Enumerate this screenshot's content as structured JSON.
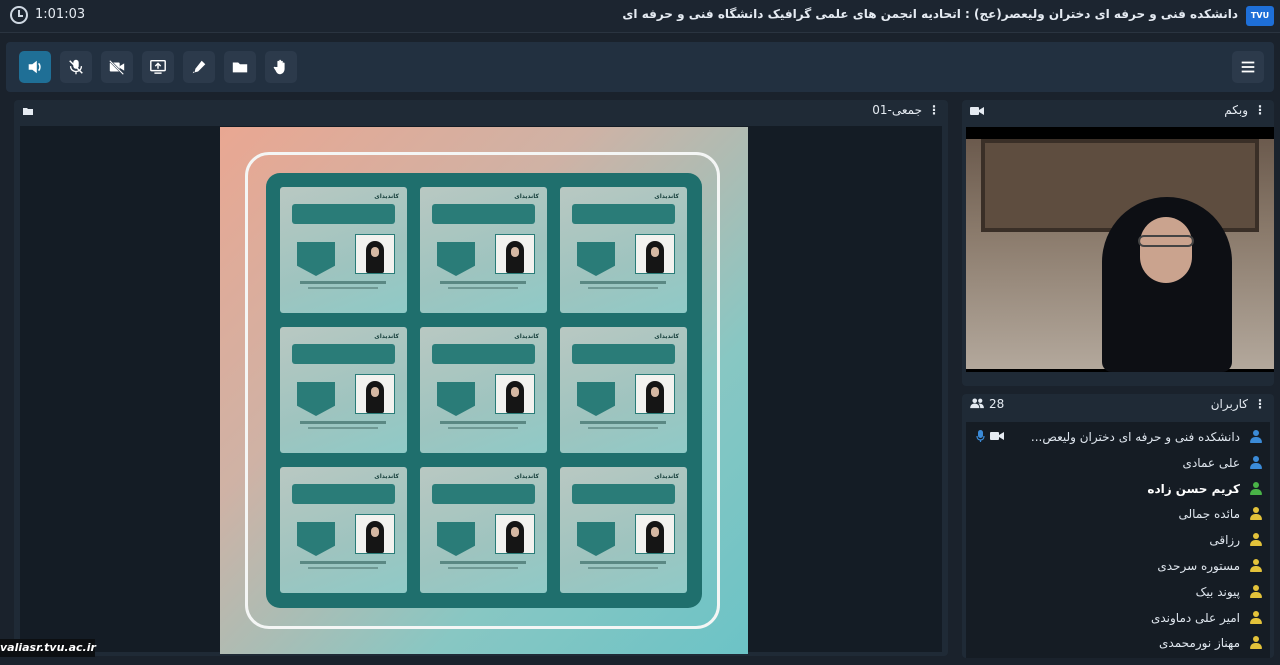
{
  "titlebar": {
    "timer": "1:01:03",
    "title": "دانشکده فنی و حرفه ای دختران ولیعصر(عج) : اتحادیه انجمن های علمی گرافیک دانشگاه فنی و حرفه ای"
  },
  "toolbar": {
    "buttons": [
      "speaker-icon",
      "mic-off-icon",
      "camera-off-icon",
      "screen-share-icon",
      "pen-icon",
      "folder-icon",
      "raise-hand-icon"
    ],
    "menu_icon": "menu-icon"
  },
  "share_panel": {
    "label": "جمعی-01"
  },
  "webcam_panel": {
    "label": "وبکم"
  },
  "users_panel": {
    "label": "کاربران",
    "count": "28",
    "users": [
      {
        "name": "دانشکده فنی و حرفه ای دختران ولیعص...",
        "color": "#3b8bd8",
        "bold": false,
        "has_media": true
      },
      {
        "name": "علی عمادی",
        "color": "#3b8bd8",
        "bold": false,
        "has_media": false
      },
      {
        "name": "کریم حسن زاده",
        "color": "#49b347",
        "bold": true,
        "has_media": false
      },
      {
        "name": "مائده جمالی",
        "color": "#e3c23a",
        "bold": false,
        "has_media": false
      },
      {
        "name": "رزاقی",
        "color": "#e3c23a",
        "bold": false,
        "has_media": false
      },
      {
        "name": "مستوره سرحدی",
        "color": "#e3c23a",
        "bold": false,
        "has_media": false
      },
      {
        "name": "پیوند بیک",
        "color": "#e3c23a",
        "bold": false,
        "has_media": false
      },
      {
        "name": "امیر علی دماوندی",
        "color": "#e3c23a",
        "bold": false,
        "has_media": false
      },
      {
        "name": "مهناز نورمحمدی",
        "color": "#e3c23a",
        "bold": false,
        "has_media": false
      }
    ]
  },
  "poster": {
    "card_caption": "کاندیدای",
    "card_count": 9
  },
  "watermark": "valiasr.tvu.ac.ir"
}
